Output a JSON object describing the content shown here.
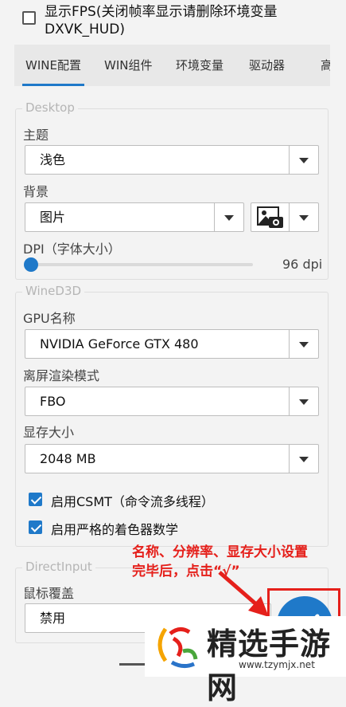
{
  "top_checkbox": {
    "label_line1": "显示FPS(关闭帧率显示请删除环境变量",
    "label_line2": "DXVK_HUD)",
    "checked": false
  },
  "tabs": [
    {
      "label": "WINE配置",
      "active": true
    },
    {
      "label": "WIN组件",
      "active": false
    },
    {
      "label": "环境变量",
      "active": false
    },
    {
      "label": "驱动器",
      "active": false
    },
    {
      "label": "高",
      "active": false
    }
  ],
  "desktop": {
    "legend": "Desktop",
    "theme_label": "主题",
    "theme_value": "浅色",
    "background_label": "背景",
    "background_value": "图片",
    "image_icon": "image-picker-icon",
    "dpi_label": "DPI（字体大小）",
    "dpi_value": "96 dpi",
    "dpi_level": 0.02
  },
  "wined3d": {
    "legend": "WineD3D",
    "gpu_label": "GPU名称",
    "gpu_value": "NVIDIA GeForce GTX 480",
    "offscreen_label": "离屏渲染模式",
    "offscreen_value": "FBO",
    "vram_label": "显存大小",
    "vram_value": "2048 MB",
    "csmt_label": "启用CSMT（命令流多线程）",
    "csmt_checked": true,
    "strict_label": "启用严格的着色器数学",
    "strict_checked": true
  },
  "directinput": {
    "legend": "DirectInput",
    "mouse_label": "鼠标覆盖",
    "mouse_value": "禁用"
  },
  "annotation": {
    "line1": "名称、分辨率、显存大小设置",
    "line2": "完毕后，点击“√”",
    "color": "#e5201b"
  },
  "fab": {
    "icon": "check-icon",
    "color": "#1f79c9"
  },
  "watermark": {
    "title": "精选手游网",
    "url": "www.tzymjx.net"
  },
  "colors": {
    "accent": "#1f79c9",
    "background": "#f3f3f3"
  }
}
